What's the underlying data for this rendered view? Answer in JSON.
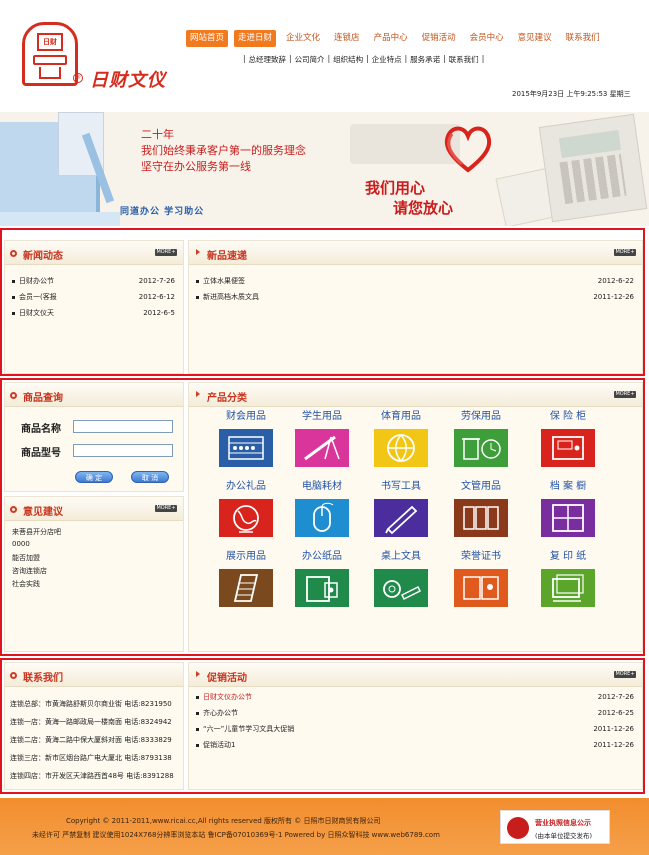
{
  "brand": {
    "name": "日财文仪",
    "seal_text": "日财",
    "registered": "®"
  },
  "nav": {
    "items": [
      "网站首页",
      "走进日财",
      "企业文化",
      "连锁店",
      "产品中心",
      "促销活动",
      "会员中心",
      "意见建议",
      "联系我们"
    ]
  },
  "subnav": {
    "items": [
      "|",
      "总经理致辞",
      "|",
      "公司简介",
      "|",
      "组织结构",
      "|",
      "企业特点",
      "|",
      "服务承诺",
      "|",
      "联系我们",
      "|"
    ]
  },
  "datetime": "2015年9月23日 上午9:25:53 星期三",
  "banner": {
    "line1": "二十年",
    "line2": "我们始终秉承客户第一的服务理念",
    "line3": "坚守在办公服务第一线",
    "slogan1": "我们用心",
    "slogan2": "请您放心",
    "tag": "同道办公 学习助公"
  },
  "more_label": "MORE+",
  "news": {
    "title": "新闻动态",
    "items": [
      {
        "text": "日财办公节",
        "date": "2012-7-26"
      },
      {
        "text": "会员一(客报",
        "date": "2012-6-12"
      },
      {
        "text": "日财文仪天",
        "date": "2012-6-5"
      }
    ]
  },
  "new_products": {
    "title": "新品速递",
    "items": [
      {
        "text": "立体水果便签",
        "date": "2012-6-22"
      },
      {
        "text": "新进高档木质文具",
        "date": "2011-12-26"
      }
    ]
  },
  "query": {
    "title": "商品查询",
    "name_label": "商品名称",
    "model_label": "商品型号",
    "name_value": "",
    "model_value": "",
    "submit_label": "确 定",
    "cancel_label": "取 消"
  },
  "suggestions": {
    "title": "意见建议",
    "items": [
      "来菩县开分店吧",
      "0000",
      "能否加盟",
      "咨询连锁店",
      "社会实践"
    ]
  },
  "categories": {
    "title": "产品分类",
    "items": [
      {
        "label": "财会用品",
        "color": "#2a5fa8",
        "icon": "abacus-icon"
      },
      {
        "label": "学生用品",
        "color": "#d9359a",
        "icon": "ruler-compass-icon"
      },
      {
        "label": "体育用品",
        "color": "#f2c614",
        "icon": "basketball-icon"
      },
      {
        "label": "劳保用品",
        "color": "#3d9e3a",
        "icon": "bin-clock-icon"
      },
      {
        "label": "保 险 柜",
        "color": "#d8241c",
        "icon": "safe-icon"
      },
      {
        "label": "办公礼品",
        "color": "#d8241c",
        "icon": "globe-icon"
      },
      {
        "label": "电脑耗材",
        "color": "#1e8ed0",
        "icon": "mouse-icon"
      },
      {
        "label": "书写工具",
        "color": "#4b2d9e",
        "icon": "pen-icon"
      },
      {
        "label": "文管用品",
        "color": "#8a3a1a",
        "icon": "binders-icon"
      },
      {
        "label": "档 案 橱",
        "color": "#7a2d9e",
        "icon": "cabinet-icon"
      },
      {
        "label": "展示用品",
        "color": "#7a4a1e",
        "icon": "display-rack-icon"
      },
      {
        "label": "办公纸品",
        "color": "#1f8a4a",
        "icon": "notebook-icon"
      },
      {
        "label": "桌上文具",
        "color": "#1f8a4a",
        "icon": "tape-stapler-icon"
      },
      {
        "label": "荣誉证书",
        "color": "#e05a1e",
        "icon": "certificate-icon"
      },
      {
        "label": "复 印 纸",
        "color": "#5aa52a",
        "icon": "paper-stack-icon"
      }
    ]
  },
  "contact": {
    "title": "联系我们",
    "items": [
      "连锁总部：市黄海路舒斯贝尔商业街 电话:8231950",
      "连锁一店：黄海一路邮政局一楼南面 电话:8324942",
      "连锁二店：黄海二路中保大厦斜对面 电话:8333829",
      "连锁三店：新市区烟台路广电大厦北 电话:8793138",
      "连锁四店：市开发区天津路西首48号 电话:8391288"
    ]
  },
  "promotions": {
    "title": "促销活动",
    "items": [
      {
        "text": "日财文仪办公节",
        "date": "2012-7-26",
        "highlight": true
      },
      {
        "text": "齐心办公节",
        "date": "2012-6-25",
        "highlight": false
      },
      {
        "text": "“六一”儿童节学习文具大促销",
        "date": "2011-12-26",
        "highlight": false
      },
      {
        "text": "促销活动1",
        "date": "2011-12-26",
        "highlight": false
      }
    ]
  },
  "footer": {
    "line1": "Copyright © 2011-2011,www.ricai.cc,All rights reserved   版权所有 © 日照市日财商贸有限公司",
    "line2": "未经许可 严禁复制 建议使用1024X768分辨率浏览本站 鲁ICP备07010369号-1 Powered by 日照众智科技 www.web6789.com",
    "license_title": "营业执照信息公示",
    "license_sub": "(由本单位提交发布)"
  }
}
